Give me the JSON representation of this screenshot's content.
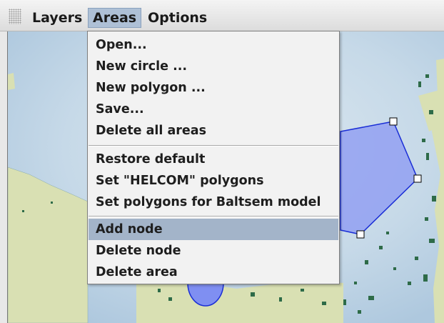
{
  "menubar": {
    "menus": [
      {
        "label": "Layers"
      },
      {
        "label": "Areas"
      },
      {
        "label": "Options"
      }
    ]
  },
  "areas_menu": {
    "groups": [
      [
        "Open...",
        "New circle ...",
        "New polygon ...",
        "Save...",
        "Delete all areas"
      ],
      [
        "Restore default",
        "Set \"HELCOM\" polygons",
        "Set polygons for Baltsem model"
      ],
      [
        "Add node",
        "Delete node",
        "Delete area"
      ]
    ],
    "highlighted": "Add node"
  },
  "colors": {
    "sea": "#bcd3e6",
    "land": "#d9e0b3",
    "polygon_fill": "#8e9cf2",
    "polygon_stroke": "#1a2ed6",
    "island": "#2e6b48",
    "highlight": "#a3b4c9"
  }
}
